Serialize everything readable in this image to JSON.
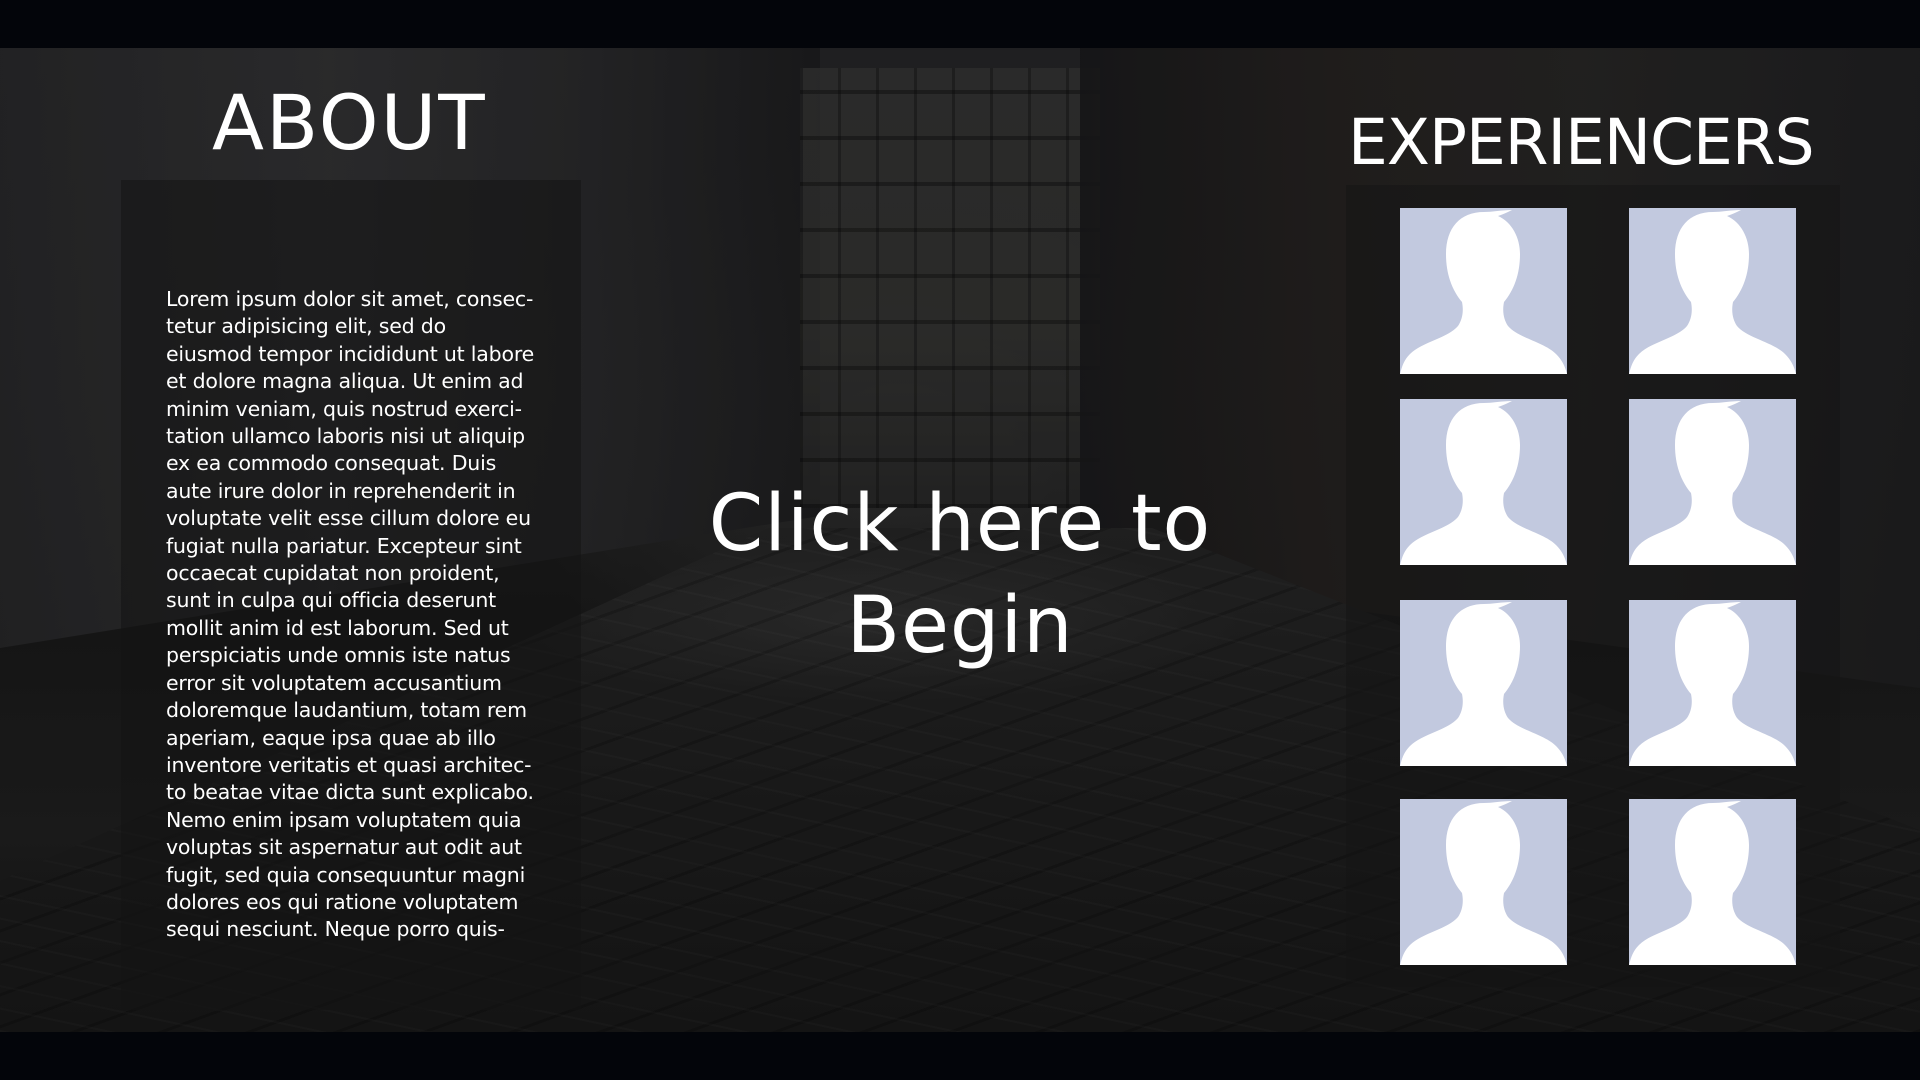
{
  "about": {
    "title": "ABOUT",
    "body": "Lorem ipsum dolor sit amet, consec­tetur adipisicing elit, sed do eiusmod tempor incididunt ut labore et dolore magna aliqua. Ut enim ad minim veniam, quis nostrud exerci­tation ullamco laboris nisi ut aliquip ex ea commodo consequat. Duis aute irure dolor in reprehenderit in voluptate velit esse cillum dolore eu fugiat nulla pariatur. Excepteur sint occaecat cupidatat non proident, sunt in culpa qui officia deserunt mollit anim id est laborum. Sed ut perspiciatis unde omnis iste natus error sit voluptatem accusantium doloremque laudantium, totam rem aperiam, eaque ipsa quae ab illo inventore veritatis et quasi architec­to beatae vitae dicta sunt explicabo. Nemo enim ipsam voluptatem quia voluptas sit aspernatur aut odit aut fugit, sed quia consequuntur magni dolores eos qui ratione voluptatem sequi nesciunt. Neque porro quis-"
  },
  "begin": {
    "line1": "Click here to",
    "line2": "Begin"
  },
  "experiencers": {
    "title": "EXPERIENCERS",
    "avatar_icon": "default-profile-silhouette-icon",
    "avatar_bg": "#c2c9df",
    "avatar_fg": "#ffffff",
    "count": 8
  }
}
